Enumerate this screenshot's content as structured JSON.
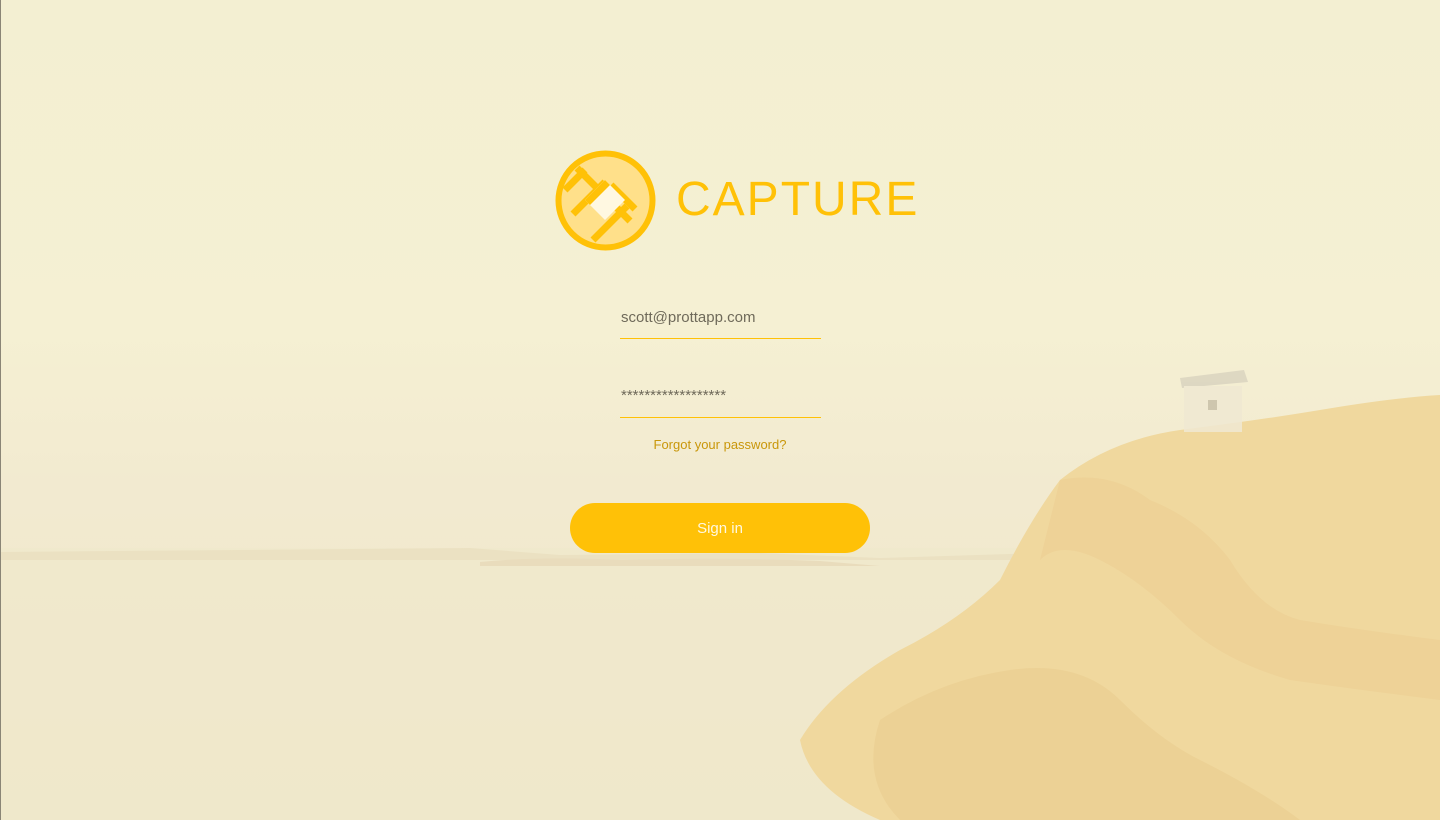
{
  "brand": {
    "name": "CAPTURE",
    "logo_icon": "capture-lens-icon",
    "accent_color": "#ffc107"
  },
  "login": {
    "email_value": "scott@prottapp.com",
    "password_value": "******************",
    "forgot_label": "Forgot your password?",
    "signin_label": "Sign in"
  }
}
